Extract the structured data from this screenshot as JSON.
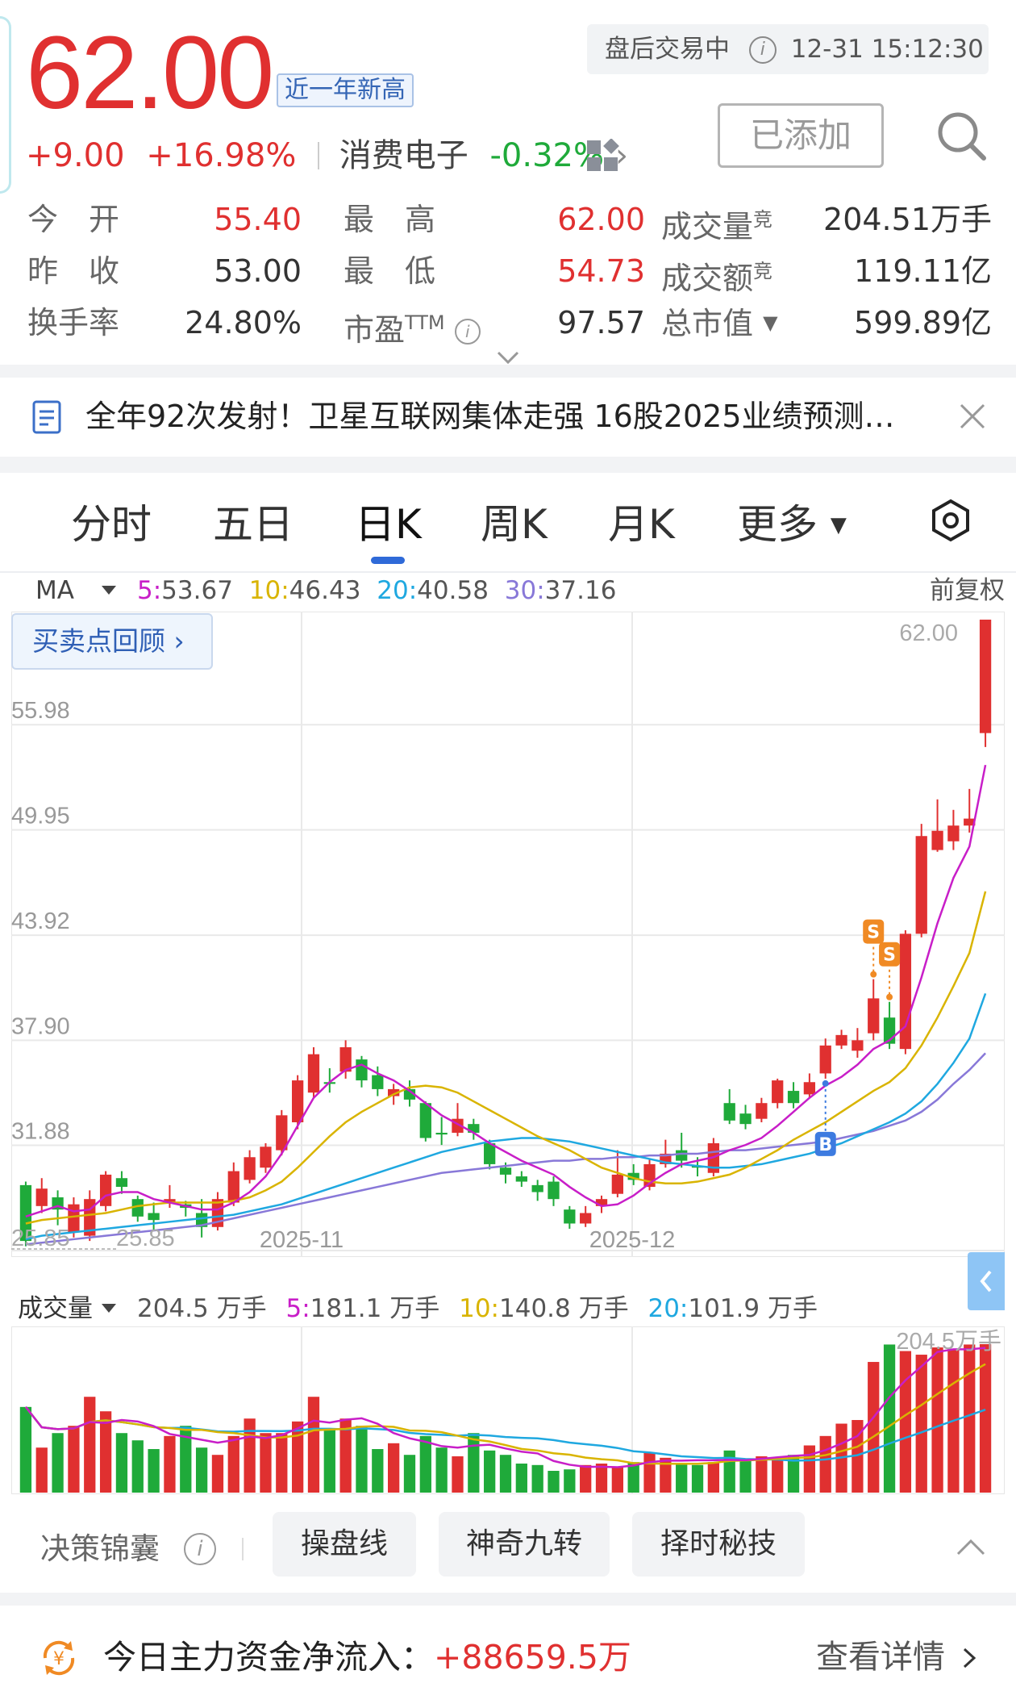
{
  "quote": {
    "price": "62.00",
    "new_high_badge": "近一年新高",
    "change": "+9.00",
    "change_pct": "+16.98%",
    "sector_name": "消费电子",
    "sector_change": "-0.32%",
    "market_status": "盘后交易中",
    "timestamp": "12-31 15:12:30",
    "added_label": "已添加"
  },
  "stats": [
    [
      {
        "label": "今　开",
        "value": "55.40",
        "color": "red"
      },
      {
        "label": "最　高",
        "value": "62.00",
        "color": "red"
      },
      {
        "label": "成交量",
        "sup": "竞",
        "value": "204.51万手",
        "color": "black"
      }
    ],
    [
      {
        "label": "昨　收",
        "value": "53.00",
        "color": "black"
      },
      {
        "label": "最　低",
        "value": "54.73",
        "color": "red"
      },
      {
        "label": "成交额",
        "sup": "竞",
        "value": "119.11亿",
        "color": "black"
      }
    ],
    [
      {
        "label": "换手率",
        "value": "24.80%",
        "color": "black"
      },
      {
        "label": "市盈",
        "sup": "TTM",
        "value": "97.57",
        "color": "black"
      },
      {
        "label": "总市值",
        "value": "599.89亿",
        "color": "black"
      }
    ]
  ],
  "news": {
    "text": "全年92次发射！卫星互联网集体走强 16股2025业绩预测…"
  },
  "tabs": [
    "分时",
    "五日",
    "日K",
    "周K",
    "月K",
    "更多"
  ],
  "active_tab": "日K",
  "ma_legend": {
    "selector": "MA",
    "items": [
      {
        "label": "5:",
        "value": "53.67",
        "color": "#c81ec8"
      },
      {
        "label": "10:",
        "value": "46.43",
        "color": "#d9b400"
      },
      {
        "label": "20:",
        "value": "40.58",
        "color": "#1fa8e0"
      },
      {
        "label": "30:",
        "value": "37.16",
        "color": "#8878d8"
      }
    ],
    "adjust": "前复权"
  },
  "buy_sell_review": "买卖点回顾",
  "chart_data": {
    "type": "candlestick",
    "y_ticks": [
      "55.98",
      "49.95",
      "43.92",
      "37.90",
      "31.88",
      "25.85"
    ],
    "ylim": [
      25.85,
      62.0
    ],
    "x_ticks": [
      "2025-11",
      "2025-12"
    ],
    "max_label": "62.00",
    "min_label": "25.85",
    "signals": [
      {
        "type": "S",
        "label": "S",
        "candle_index": 53
      },
      {
        "type": "S",
        "label": "S",
        "candle_index": 54
      },
      {
        "type": "B",
        "label": "B",
        "candle_index": 50
      }
    ],
    "candles": [
      {
        "o": 29.6,
        "c": 26.4,
        "h": 29.8,
        "l": 26.1
      },
      {
        "o": 28.4,
        "c": 29.4,
        "h": 30.0,
        "l": 28.0
      },
      {
        "o": 28.9,
        "c": 28.2,
        "h": 29.3,
        "l": 27.3
      },
      {
        "o": 26.9,
        "c": 28.5,
        "h": 28.9,
        "l": 26.6
      },
      {
        "o": 26.7,
        "c": 28.8,
        "h": 29.3,
        "l": 26.4
      },
      {
        "o": 28.4,
        "c": 30.2,
        "h": 30.4,
        "l": 28.1
      },
      {
        "o": 30.0,
        "c": 29.5,
        "h": 30.4,
        "l": 29.1
      },
      {
        "o": 28.8,
        "c": 27.8,
        "h": 29.0,
        "l": 27.5
      },
      {
        "o": 28.0,
        "c": 27.6,
        "h": 28.6,
        "l": 27.0
      },
      {
        "o": 28.6,
        "c": 28.8,
        "h": 29.6,
        "l": 28.3
      },
      {
        "o": 28.5,
        "c": 28.3,
        "h": 28.7,
        "l": 27.8
      },
      {
        "o": 28.0,
        "c": 27.2,
        "h": 28.8,
        "l": 26.6
      },
      {
        "o": 27.2,
        "c": 28.8,
        "h": 29.2,
        "l": 27.0
      },
      {
        "o": 28.6,
        "c": 30.4,
        "h": 30.9,
        "l": 28.4
      },
      {
        "o": 29.9,
        "c": 31.2,
        "h": 31.6,
        "l": 29.7
      },
      {
        "o": 30.6,
        "c": 31.8,
        "h": 32.0,
        "l": 30.3
      },
      {
        "o": 31.6,
        "c": 33.6,
        "h": 33.9,
        "l": 31.3
      },
      {
        "o": 33.2,
        "c": 35.6,
        "h": 35.9,
        "l": 32.8
      },
      {
        "o": 34.9,
        "c": 37.1,
        "h": 37.5,
        "l": 34.6
      },
      {
        "o": 35.5,
        "c": 35.4,
        "h": 36.3,
        "l": 34.9
      },
      {
        "o": 36.1,
        "c": 37.5,
        "h": 37.9,
        "l": 35.7
      },
      {
        "o": 36.8,
        "c": 35.6,
        "h": 37.0,
        "l": 35.2
      },
      {
        "o": 35.9,
        "c": 35.1,
        "h": 36.4,
        "l": 34.7
      },
      {
        "o": 34.7,
        "c": 35.1,
        "h": 35.4,
        "l": 34.2
      },
      {
        "o": 35.1,
        "c": 34.5,
        "h": 35.6,
        "l": 34.1
      },
      {
        "o": 34.3,
        "c": 32.3,
        "h": 34.4,
        "l": 32.1
      },
      {
        "o": 32.6,
        "c": 32.5,
        "h": 33.5,
        "l": 31.9
      },
      {
        "o": 32.6,
        "c": 33.4,
        "h": 34.3,
        "l": 32.4
      },
      {
        "o": 33.1,
        "c": 32.6,
        "h": 33.4,
        "l": 32.2
      },
      {
        "o": 32.0,
        "c": 30.8,
        "h": 32.2,
        "l": 30.5
      },
      {
        "o": 30.6,
        "c": 30.2,
        "h": 30.9,
        "l": 29.7
      },
      {
        "o": 30.1,
        "c": 29.8,
        "h": 30.4,
        "l": 29.5
      },
      {
        "o": 29.6,
        "c": 29.2,
        "h": 29.9,
        "l": 28.7
      },
      {
        "o": 29.8,
        "c": 28.8,
        "h": 30.1,
        "l": 28.4
      },
      {
        "o": 28.2,
        "c": 27.4,
        "h": 28.4,
        "l": 27.1
      },
      {
        "o": 27.4,
        "c": 28.0,
        "h": 28.4,
        "l": 27.2
      },
      {
        "o": 28.4,
        "c": 28.8,
        "h": 29.0,
        "l": 28.0
      },
      {
        "o": 29.1,
        "c": 30.2,
        "h": 31.6,
        "l": 28.9
      },
      {
        "o": 30.3,
        "c": 29.9,
        "h": 30.8,
        "l": 29.6
      },
      {
        "o": 29.5,
        "c": 30.8,
        "h": 31.1,
        "l": 29.3
      },
      {
        "o": 30.8,
        "c": 31.4,
        "h": 32.2,
        "l": 30.6
      },
      {
        "o": 31.6,
        "c": 31.0,
        "h": 32.6,
        "l": 30.6
      },
      {
        "o": 30.7,
        "c": 30.6,
        "h": 31.2,
        "l": 30.1
      },
      {
        "o": 30.3,
        "c": 32.0,
        "h": 32.3,
        "l": 30.1
      },
      {
        "o": 34.3,
        "c": 33.3,
        "h": 35.1,
        "l": 33.1
      },
      {
        "o": 33.7,
        "c": 33.1,
        "h": 34.2,
        "l": 32.8
      },
      {
        "o": 33.4,
        "c": 34.3,
        "h": 34.6,
        "l": 33.2
      },
      {
        "o": 34.3,
        "c": 35.6,
        "h": 35.7,
        "l": 34.0
      },
      {
        "o": 35.0,
        "c": 34.3,
        "h": 35.5,
        "l": 34.0
      },
      {
        "o": 34.8,
        "c": 35.5,
        "h": 36.0,
        "l": 34.6
      },
      {
        "o": 36.0,
        "c": 37.6,
        "h": 38.0,
        "l": 35.7
      },
      {
        "o": 37.6,
        "c": 38.2,
        "h": 38.5,
        "l": 37.4
      },
      {
        "o": 37.3,
        "c": 37.9,
        "h": 38.6,
        "l": 36.9
      },
      {
        "o": 38.3,
        "c": 40.3,
        "h": 41.4,
        "l": 37.9
      },
      {
        "o": 39.2,
        "c": 37.7,
        "h": 40.1,
        "l": 37.4
      },
      {
        "o": 37.4,
        "c": 44.0,
        "h": 44.2,
        "l": 37.1
      },
      {
        "o": 44.0,
        "c": 49.6,
        "h": 50.3,
        "l": 43.8
      },
      {
        "o": 48.8,
        "c": 49.9,
        "h": 51.7,
        "l": 48.7
      },
      {
        "o": 49.3,
        "c": 50.2,
        "h": 51.1,
        "l": 48.8
      },
      {
        "o": 50.2,
        "c": 50.6,
        "h": 52.3,
        "l": 49.8
      },
      {
        "o": 55.5,
        "c": 62.0,
        "h": 62.0,
        "l": 54.7
      }
    ],
    "ma5": [
      27.8,
      28.1,
      28.4,
      28.1,
      28.2,
      29.0,
      29.2,
      29.2,
      28.8,
      28.6,
      28.4,
      28.2,
      28.2,
      28.6,
      29.2,
      30.1,
      31.4,
      33.0,
      34.6,
      35.5,
      36.2,
      36.5,
      36.0,
      35.6,
      35.0,
      34.3,
      33.6,
      33.1,
      32.6,
      32.0,
      31.5,
      31.0,
      30.6,
      30.2,
      29.5,
      28.9,
      28.4,
      28.5,
      29.0,
      29.7,
      30.3,
      30.8,
      31.0,
      31.2,
      31.6,
      31.9,
      32.3,
      33.0,
      33.8,
      34.6,
      35.3,
      35.8,
      36.5,
      37.4,
      37.9,
      38.7,
      41.5,
      44.6,
      47.2,
      49.0,
      53.67
    ],
    "ma10": [
      27.4,
      27.6,
      27.7,
      27.8,
      27.9,
      28.0,
      28.2,
      28.4,
      28.5,
      28.6,
      28.6,
      28.6,
      28.6,
      28.7,
      28.9,
      29.3,
      29.8,
      30.6,
      31.5,
      32.4,
      33.2,
      33.8,
      34.3,
      34.8,
      35.2,
      35.3,
      35.2,
      34.9,
      34.4,
      33.9,
      33.4,
      32.9,
      32.4,
      32.0,
      31.6,
      31.1,
      30.6,
      30.3,
      30.0,
      29.8,
      29.7,
      29.7,
      29.8,
      30.0,
      30.2,
      30.6,
      31.1,
      31.6,
      32.2,
      32.7,
      33.2,
      33.8,
      34.4,
      35.0,
      35.5,
      36.3,
      37.6,
      39.2,
      41.0,
      42.9,
      46.43
    ],
    "ma20": [
      26.5,
      26.7,
      26.8,
      26.9,
      27.0,
      27.1,
      27.2,
      27.3,
      27.4,
      27.5,
      27.6,
      27.7,
      27.8,
      27.9,
      28.1,
      28.3,
      28.5,
      28.8,
      29.1,
      29.4,
      29.7,
      30.0,
      30.3,
      30.6,
      30.9,
      31.2,
      31.5,
      31.7,
      31.9,
      32.1,
      32.2,
      32.3,
      32.3,
      32.2,
      32.1,
      31.9,
      31.7,
      31.5,
      31.3,
      31.1,
      30.9,
      30.8,
      30.7,
      30.6,
      30.6,
      30.7,
      30.8,
      31.0,
      31.2,
      31.4,
      31.7,
      32.0,
      32.4,
      32.8,
      33.2,
      33.7,
      34.4,
      35.4,
      36.6,
      38.0,
      40.58
    ],
    "ma30": [
      26.2,
      26.3,
      26.4,
      26.5,
      26.6,
      26.7,
      26.8,
      26.9,
      27.0,
      27.1,
      27.2,
      27.3,
      27.5,
      27.7,
      27.9,
      28.1,
      28.3,
      28.5,
      28.7,
      28.9,
      29.1,
      29.3,
      29.5,
      29.7,
      29.9,
      30.1,
      30.3,
      30.4,
      30.5,
      30.6,
      30.7,
      30.8,
      30.9,
      31.0,
      31.0,
      31.1,
      31.1,
      31.2,
      31.2,
      31.3,
      31.3,
      31.4,
      31.4,
      31.5,
      31.6,
      31.6,
      31.7,
      31.8,
      31.9,
      32.0,
      32.1,
      32.3,
      32.5,
      32.7,
      33.0,
      33.3,
      33.8,
      34.5,
      35.4,
      36.2,
      37.16
    ],
    "volume_labels": {
      "max": "204.5万手"
    },
    "volumes": [
      118,
      62,
      82,
      92,
      132,
      112,
      82,
      72,
      60,
      78,
      92,
      62,
      52,
      78,
      102,
      82,
      82,
      98,
      132,
      88,
      102,
      92,
      60,
      68,
      52,
      78,
      62,
      50,
      82,
      58,
      52,
      40,
      38,
      30,
      32,
      38,
      40,
      35,
      42,
      55,
      48,
      40,
      38,
      42,
      58,
      45,
      50,
      48,
      52,
      65,
      78,
      95,
      100,
      180,
      204,
      195,
      190,
      200,
      198,
      204,
      204.5
    ]
  },
  "volume_legend": {
    "selector": "成交量",
    "current": "204.5 万手",
    "items": [
      {
        "label": "5:",
        "value": "181.1 万手",
        "color": "#c81ec8"
      },
      {
        "label": "10:",
        "value": "140.8 万手",
        "color": "#d9b400"
      },
      {
        "label": "20:",
        "value": "101.9 万手",
        "color": "#1fa8e0"
      }
    ]
  },
  "tools": {
    "title": "决策锦囊",
    "chips": [
      "操盘线",
      "神奇九转",
      "择时秘技"
    ]
  },
  "fund_flow": {
    "label": "今日主力资金净流入：",
    "value": "+88659.5万",
    "link": "查看详情"
  },
  "colors": {
    "up": "#e03030",
    "down": "#1faa3a",
    "accent": "#2f6ad8"
  }
}
